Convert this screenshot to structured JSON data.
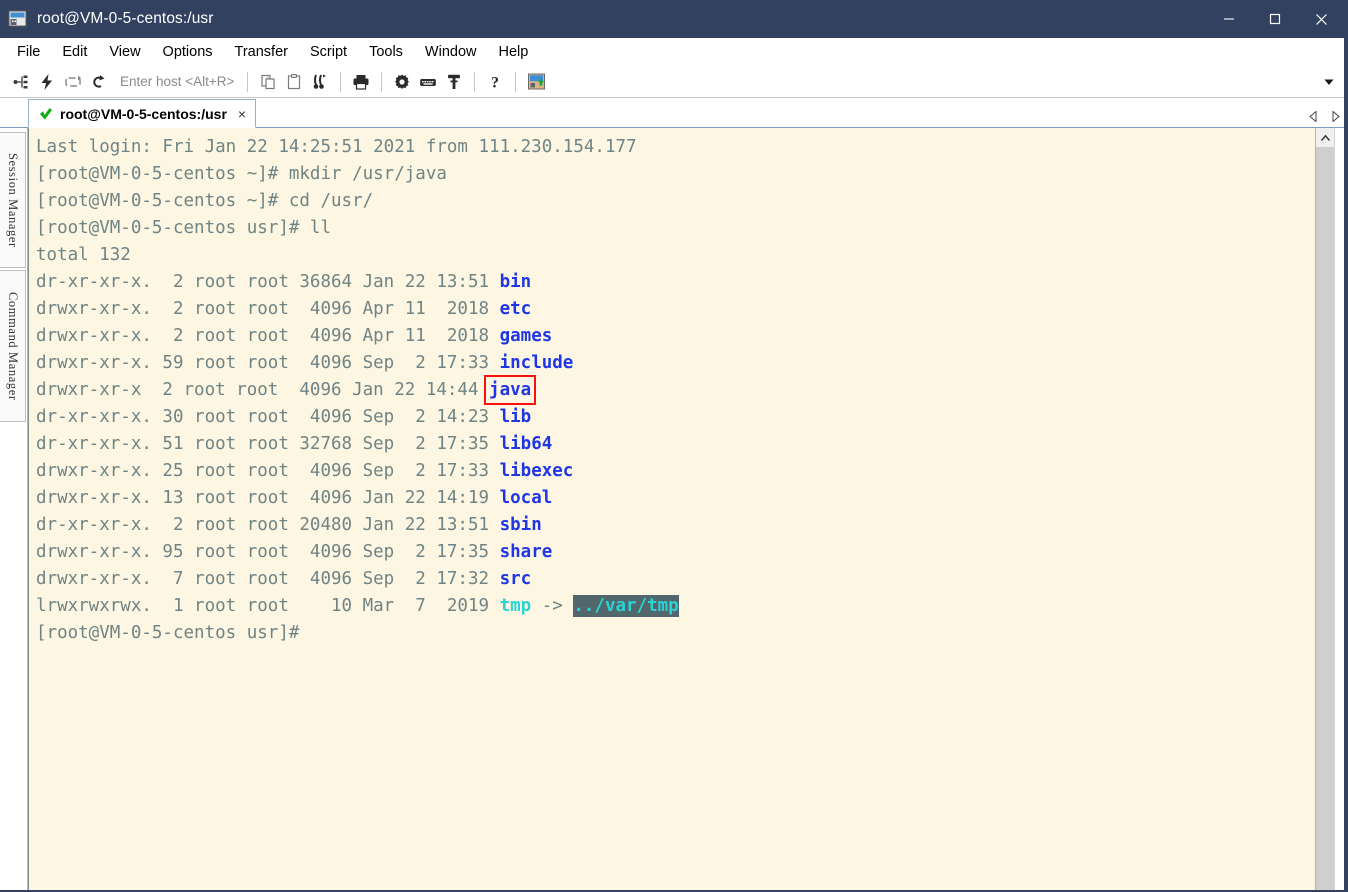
{
  "window": {
    "title": "root@VM-0-5-centos:/usr",
    "app_icon": "terminal-window-icon",
    "minimize_label": "Minimize",
    "maximize_label": "Maximize",
    "close_label": "Close"
  },
  "menu": {
    "items": [
      {
        "label": "File"
      },
      {
        "label": "Edit"
      },
      {
        "label": "View"
      },
      {
        "label": "Options"
      },
      {
        "label": "Transfer"
      },
      {
        "label": "Script"
      },
      {
        "label": "Tools"
      },
      {
        "label": "Window"
      },
      {
        "label": "Help"
      }
    ]
  },
  "toolbar": {
    "host_placeholder": "Enter host <Alt+R>",
    "host_value": "",
    "items": [
      {
        "name": "connect-icon",
        "tip": "Connect"
      },
      {
        "name": "quick-connect-icon",
        "tip": "Quick Connect"
      },
      {
        "name": "reconnect-icon",
        "tip": "Reconnect"
      },
      {
        "name": "reconnect-all-icon",
        "tip": "Reconnect All"
      },
      {
        "name": "copy-icon",
        "tip": "Copy"
      },
      {
        "name": "paste-icon",
        "tip": "Paste"
      },
      {
        "name": "find-icon",
        "tip": "Find"
      },
      {
        "name": "print-icon",
        "tip": "Print"
      },
      {
        "name": "settings-icon",
        "tip": "Session Options"
      },
      {
        "name": "keyboard-icon",
        "tip": "Keymap Editor"
      },
      {
        "name": "key-icon",
        "tip": "Public Key"
      },
      {
        "name": "help-icon",
        "tip": "Help"
      },
      {
        "name": "secure-shell-icon",
        "tip": "Secure Shell"
      }
    ],
    "overflow_label": "More toolbar buttons"
  },
  "tabs": {
    "items": [
      {
        "label": "root@VM-0-5-centos:/usr",
        "status_icon": "green-check-icon",
        "close_label": "×",
        "active": true
      }
    ],
    "nav_prev_label": "Scroll tabs left",
    "nav_next_label": "Scroll tabs right"
  },
  "sidebar": {
    "items": [
      {
        "label": "Session Manager",
        "name": "sidebar-item-session-manager"
      },
      {
        "label": "Command Manager",
        "name": "sidebar-item-command-manager"
      }
    ]
  },
  "colors": {
    "terminal_bg": "#fdf6e3",
    "terminal_fg": "#6f8484",
    "dir_color": "#1f36e6",
    "symlink_color": "#2ad4d4",
    "symlink_target_bg": "#52676b",
    "highlight_box": "#fa0f0f",
    "titlebar_bg": "#31415f"
  },
  "terminal": {
    "lines": [
      {
        "segments": [
          {
            "text": "Last login: Fri Jan 22 14:25:51 2021 from 111.230.154.177",
            "style": "default"
          }
        ]
      },
      {
        "segments": [
          {
            "text": "[root@VM-0-5-centos ~]# mkdir /usr/java",
            "style": "default"
          }
        ]
      },
      {
        "segments": [
          {
            "text": "[root@VM-0-5-centos ~]# cd /usr/",
            "style": "default"
          }
        ]
      },
      {
        "segments": [
          {
            "text": "[root@VM-0-5-centos usr]# ll",
            "style": "default"
          }
        ]
      },
      {
        "segments": [
          {
            "text": "total 132",
            "style": "default"
          }
        ]
      },
      {
        "segments": [
          {
            "text": "dr-xr-xr-x.  2 root root 36864 Jan 22 13:51 ",
            "style": "default"
          },
          {
            "text": "bin",
            "style": "dir"
          }
        ]
      },
      {
        "segments": [
          {
            "text": "drwxr-xr-x.  2 root root  4096 Apr 11  2018 ",
            "style": "default"
          },
          {
            "text": "etc",
            "style": "dir"
          }
        ]
      },
      {
        "segments": [
          {
            "text": "drwxr-xr-x.  2 root root  4096 Apr 11  2018 ",
            "style": "default"
          },
          {
            "text": "games",
            "style": "dir"
          }
        ]
      },
      {
        "segments": [
          {
            "text": "drwxr-xr-x. 59 root root  4096 Sep  2 17:33 ",
            "style": "default"
          },
          {
            "text": "include",
            "style": "dir"
          }
        ]
      },
      {
        "segments": [
          {
            "text": "drwxr-xr-x  2 root root  4096 Jan 22 14:44 ",
            "style": "default"
          },
          {
            "text": "java",
            "style": "dir",
            "highlight": true
          }
        ]
      },
      {
        "segments": [
          {
            "text": "dr-xr-xr-x. 30 root root  4096 Sep  2 14:23 ",
            "style": "default"
          },
          {
            "text": "lib",
            "style": "dir"
          }
        ]
      },
      {
        "segments": [
          {
            "text": "dr-xr-xr-x. 51 root root 32768 Sep  2 17:35 ",
            "style": "default"
          },
          {
            "text": "lib64",
            "style": "dir"
          }
        ]
      },
      {
        "segments": [
          {
            "text": "drwxr-xr-x. 25 root root  4096 Sep  2 17:33 ",
            "style": "default"
          },
          {
            "text": "libexec",
            "style": "dir"
          }
        ]
      },
      {
        "segments": [
          {
            "text": "drwxr-xr-x. 13 root root  4096 Jan 22 14:19 ",
            "style": "default"
          },
          {
            "text": "local",
            "style": "dir"
          }
        ]
      },
      {
        "segments": [
          {
            "text": "dr-xr-xr-x.  2 root root 20480 Jan 22 13:51 ",
            "style": "default"
          },
          {
            "text": "sbin",
            "style": "dir"
          }
        ]
      },
      {
        "segments": [
          {
            "text": "drwxr-xr-x. 95 root root  4096 Sep  2 17:35 ",
            "style": "default"
          },
          {
            "text": "share",
            "style": "dir"
          }
        ]
      },
      {
        "segments": [
          {
            "text": "drwxr-xr-x.  7 root root  4096 Sep  2 17:32 ",
            "style": "default"
          },
          {
            "text": "src",
            "style": "dir"
          }
        ]
      },
      {
        "segments": [
          {
            "text": "lrwxrwxrwx.  1 root root    10 Mar  7  2019 ",
            "style": "default"
          },
          {
            "text": "tmp",
            "style": "link"
          },
          {
            "text": " -> ",
            "style": "default"
          },
          {
            "text": "../var/tmp",
            "style": "linktgt"
          }
        ]
      },
      {
        "segments": [
          {
            "text": "[root@VM-0-5-centos usr]#",
            "style": "default"
          }
        ]
      }
    ]
  },
  "scrollbar": {
    "up_label": "Scroll up",
    "position_percent": 0
  }
}
